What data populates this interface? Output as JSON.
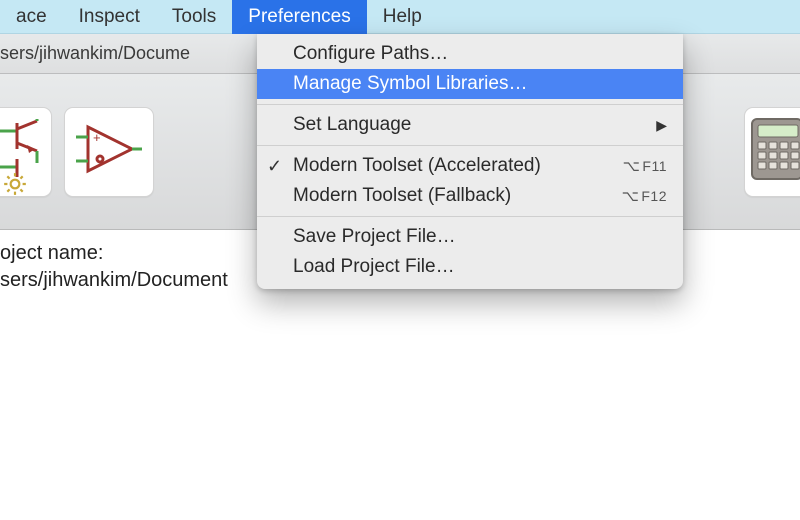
{
  "menubar": {
    "items": [
      "ace",
      "Inspect",
      "Tools",
      "Preferences",
      "Help"
    ],
    "open_index": 3
  },
  "pathbar": {
    "text": "sers/jihwankim/Docume"
  },
  "gear_visible": true,
  "project": {
    "line1": "oject name:",
    "line2": "sers/jihwankim/Document"
  },
  "dropdown": {
    "sections": [
      {
        "items": [
          {
            "label": "Configure Paths…",
            "highlight": false
          },
          {
            "label": "Manage Symbol Libraries…",
            "highlight": true
          }
        ]
      },
      {
        "items": [
          {
            "label": "Set Language",
            "submenu": true
          }
        ]
      },
      {
        "items": [
          {
            "label": "Modern Toolset (Accelerated)",
            "checked": true,
            "shortcut": "F11"
          },
          {
            "label": "Modern Toolset (Fallback)",
            "shortcut": "F12"
          }
        ]
      },
      {
        "items": [
          {
            "label": "Save Project File…"
          },
          {
            "label": "Load Project File…"
          }
        ]
      }
    ]
  },
  "icons": {
    "transistor": "transistor-icon",
    "opamp": "opamp-icon",
    "calculator": "calculator-icon",
    "gear": "gear-icon"
  }
}
